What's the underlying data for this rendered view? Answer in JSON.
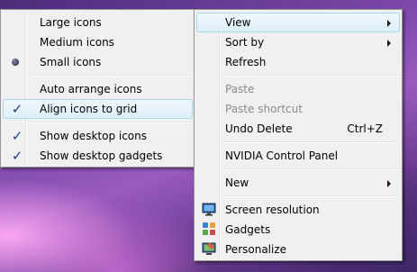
{
  "submenu": {
    "items": [
      {
        "label": "Large icons",
        "mark": "none"
      },
      {
        "label": "Medium icons",
        "mark": "none"
      },
      {
        "label": "Small icons",
        "mark": "radio"
      },
      {
        "label": "Auto arrange icons",
        "mark": "none"
      },
      {
        "label": "Align icons to grid",
        "mark": "check",
        "highlighted": true
      },
      {
        "label": "Show desktop icons",
        "mark": "check"
      },
      {
        "label": "Show desktop gadgets",
        "mark": "check"
      }
    ]
  },
  "context_menu": {
    "items": [
      {
        "label": "View",
        "submenu": true,
        "highlighted": true
      },
      {
        "label": "Sort by",
        "submenu": true
      },
      {
        "label": "Refresh"
      },
      {
        "label": "Paste",
        "disabled": true
      },
      {
        "label": "Paste shortcut",
        "disabled": true
      },
      {
        "label": "Undo Delete",
        "shortcut": "Ctrl+Z"
      },
      {
        "label": "NVIDIA Control Panel"
      },
      {
        "label": "New",
        "submenu": true
      },
      {
        "label": "Screen resolution",
        "icon": "monitor-icon"
      },
      {
        "label": "Gadgets",
        "icon": "gadgets-icon"
      },
      {
        "label": "Personalize",
        "icon": "personalize-icon"
      }
    ]
  },
  "colors": {
    "highlight_border": "#a8d8eb",
    "menu_background": "#f0f0f0",
    "disabled_text": "#8a8a8a"
  }
}
